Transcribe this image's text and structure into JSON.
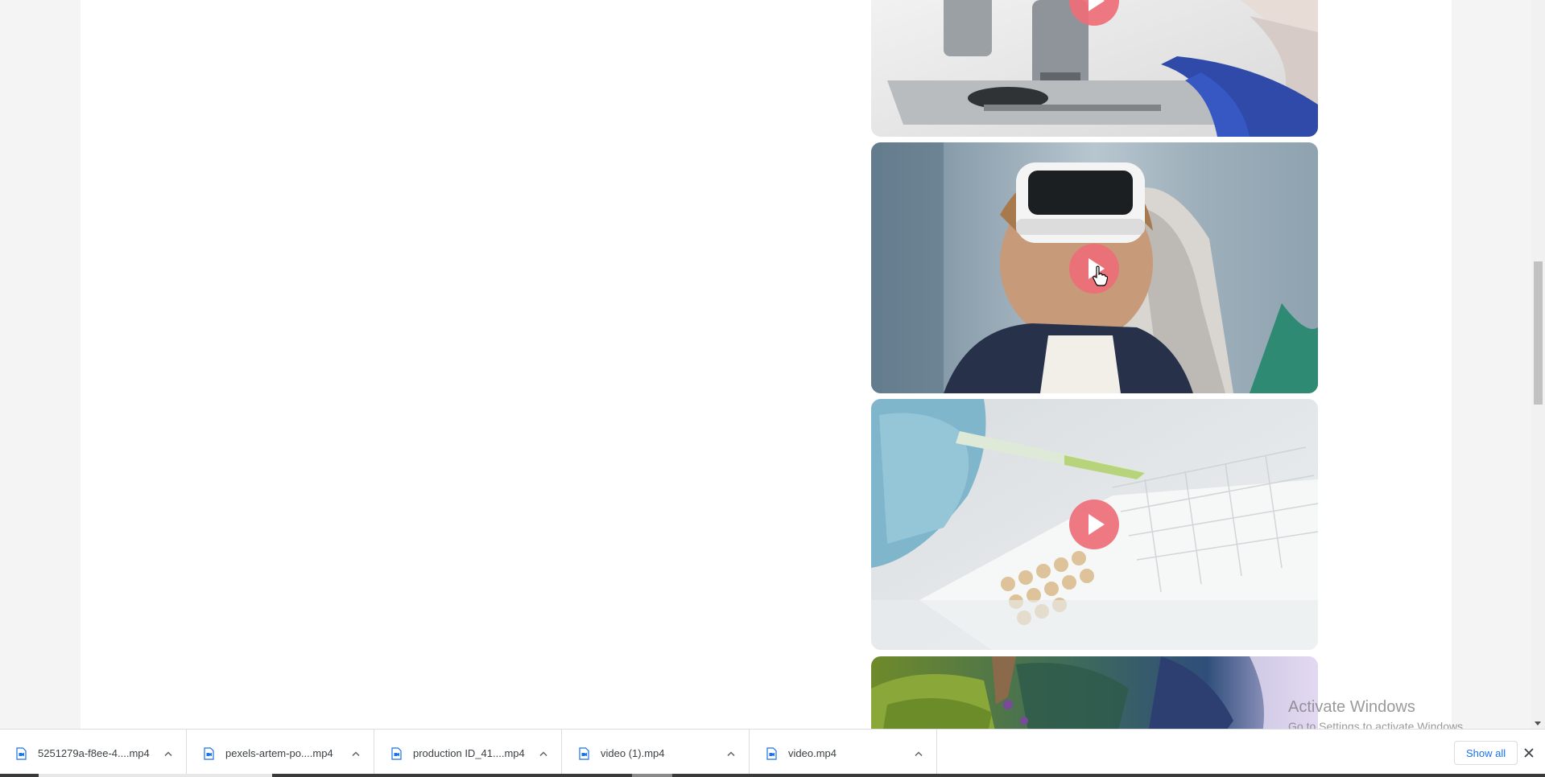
{
  "videos": [
    {
      "subject": "microscope",
      "play_label": "Play"
    },
    {
      "subject": "vr-headset-child",
      "play_label": "Play"
    },
    {
      "subject": "lab-pipette-well-plate",
      "play_label": "Play"
    },
    {
      "subject": "fantasy-forest",
      "play_label": "Play"
    }
  ],
  "watermark": {
    "line1": "Activate Windows",
    "line2": "Go to Settings to activate Windows."
  },
  "downloads": {
    "items": [
      {
        "name": "5251279a-f8ee-4....mp4",
        "icon": "video-file-icon"
      },
      {
        "name": "pexels-artem-po....mp4",
        "icon": "video-file-icon"
      },
      {
        "name": "production ID_41....mp4",
        "icon": "video-file-icon"
      },
      {
        "name": "video (1).mp4",
        "icon": "video-file-icon"
      },
      {
        "name": "video.mp4",
        "icon": "video-file-icon"
      }
    ],
    "show_all_label": "Show all"
  },
  "colors": {
    "play_button": "#ee6e78",
    "show_all_text": "#1a73e8"
  }
}
